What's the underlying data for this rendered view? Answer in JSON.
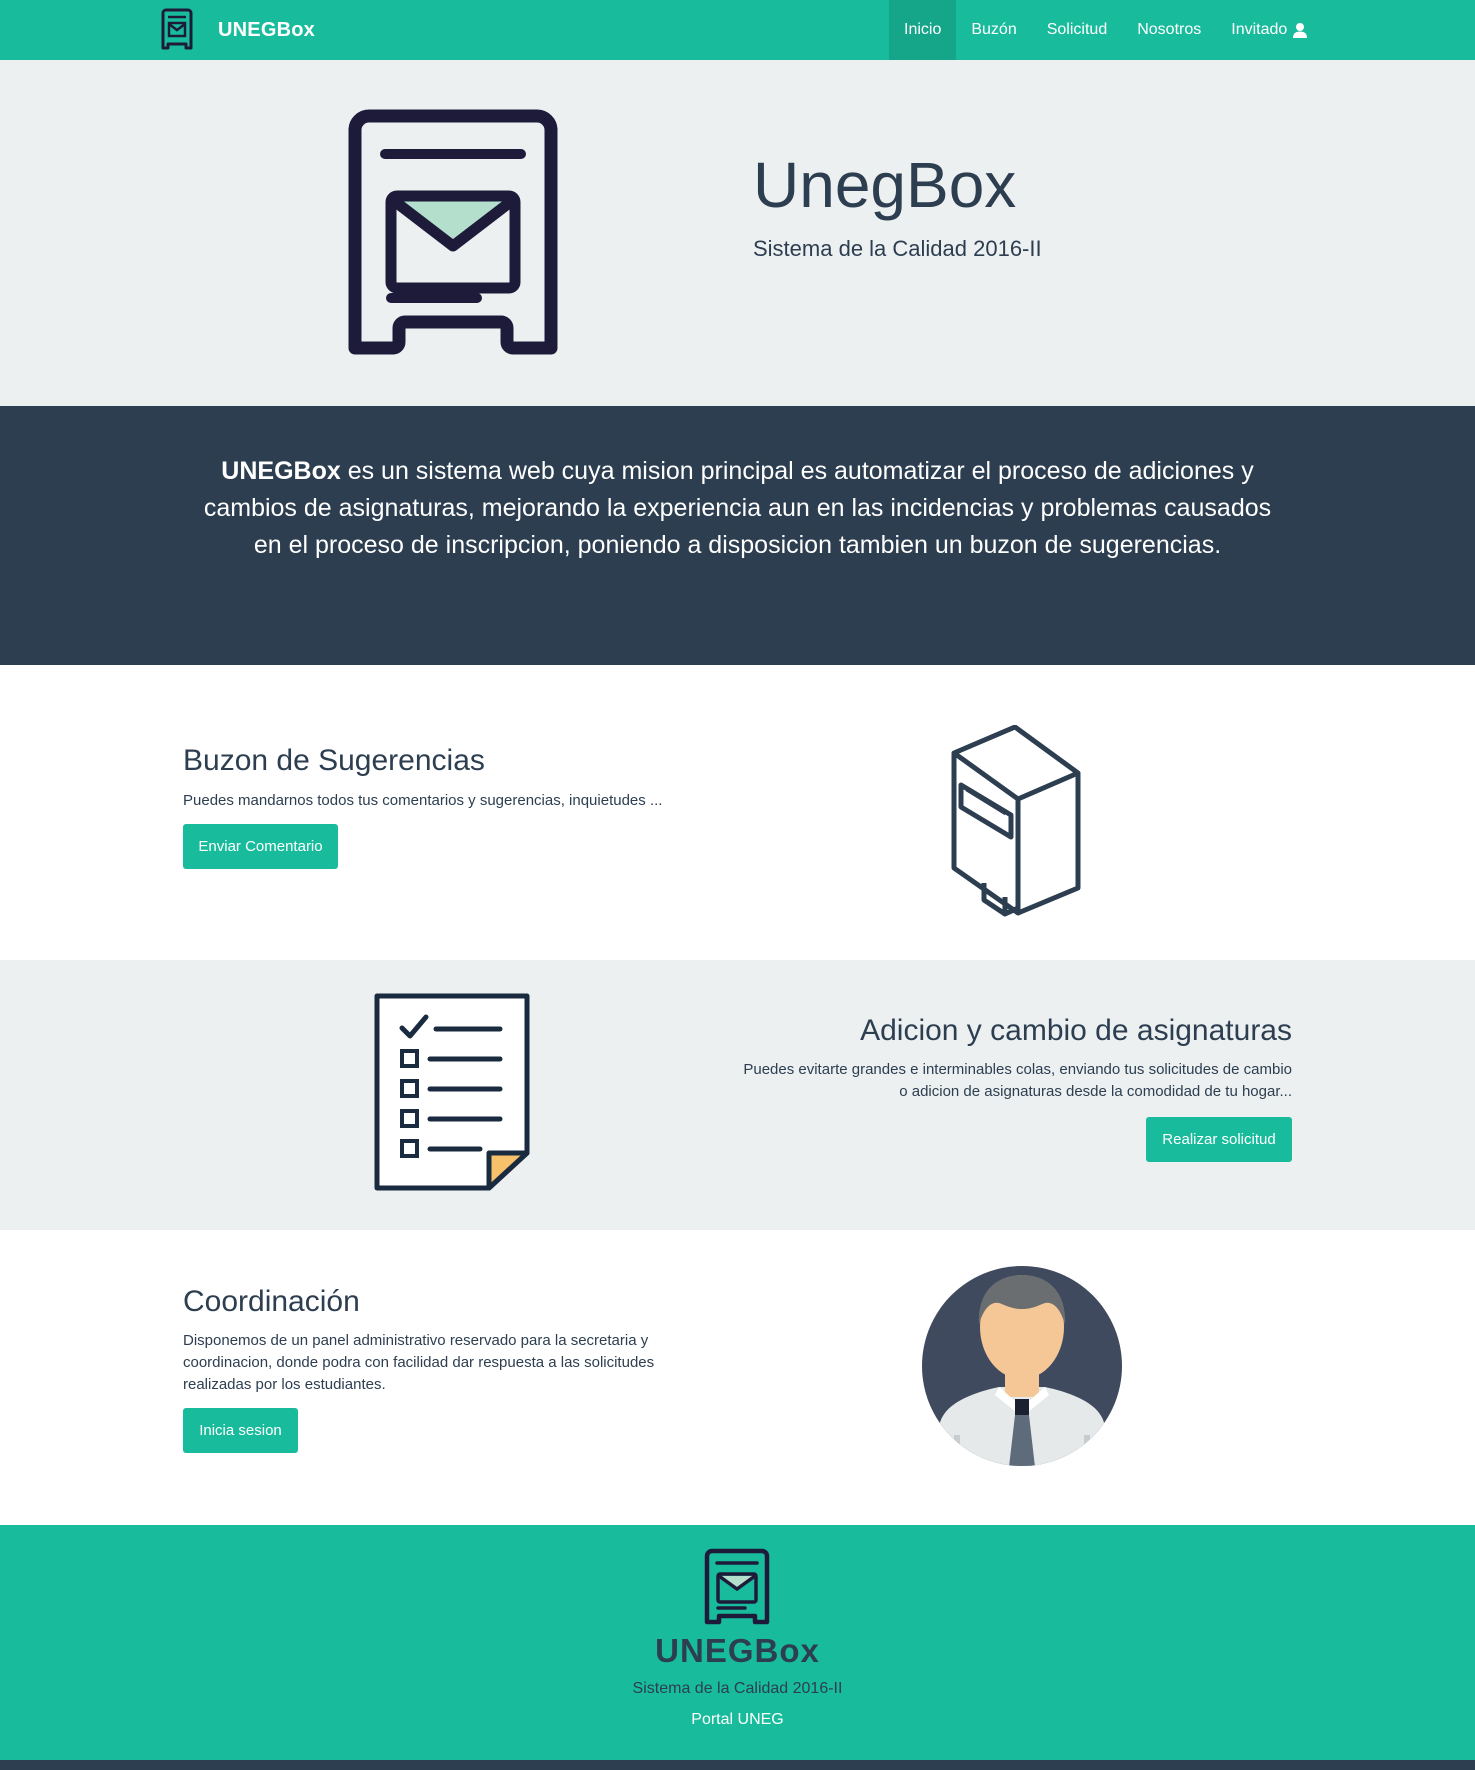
{
  "navbar": {
    "brand": "UNEGBox",
    "items": [
      {
        "label": "Inicio",
        "active": true
      },
      {
        "label": "Buzón"
      },
      {
        "label": "Solicitud"
      },
      {
        "label": "Nosotros"
      },
      {
        "label": "Invitado"
      }
    ],
    "user_icon": "user-icon"
  },
  "hero": {
    "title": "UnegBox",
    "subtitle": "Sistema de la Calidad 2016-II",
    "icon": "mailbox-logo-icon"
  },
  "mission": {
    "brand": "UNEGBox",
    "text": " es un sistema web cuya mision principal es automatizar el proceso de adiciones y cambios de asignaturas, mejorando la experiencia aun en las incidencias y problemas causados en el proceso de inscripcion, poniendo a disposicion tambien un buzon de sugerencias."
  },
  "features": [
    {
      "title": "Buzon de Sugerencias",
      "description": "Puedes mandarnos todos tus comentarios y sugerencias, inquietudes ...",
      "button": "Enviar Comentario",
      "icon": "mailbox-3d-icon"
    },
    {
      "title": "Adicion y cambio de asignaturas",
      "description": "Puedes evitarte grandes e interminables colas, enviando tus solicitudes de cambio o adicion de asignaturas desde la comodidad de tu hogar...",
      "button": "Realizar solicitud",
      "icon": "checklist-icon"
    },
    {
      "title": "Coordinación",
      "description": "Disponemos de un panel administrativo reservado para la secretaria y coordinacion, donde podra con facilidad dar respuesta a las solicitudes realizadas por los estudiantes.",
      "button": "Inicia sesion",
      "icon": "admin-avatar-icon"
    }
  ],
  "footer": {
    "brand": "UNEGBox",
    "subtitle": "Sistema de la Calidad 2016-II",
    "link": "Portal UNEG"
  },
  "colors": {
    "primary": "#18bc9c",
    "dark": "#2c3e50",
    "light": "#ecf0f1",
    "accent_mail": "#b3dfcc",
    "accent_paper": "#f7c06b"
  }
}
